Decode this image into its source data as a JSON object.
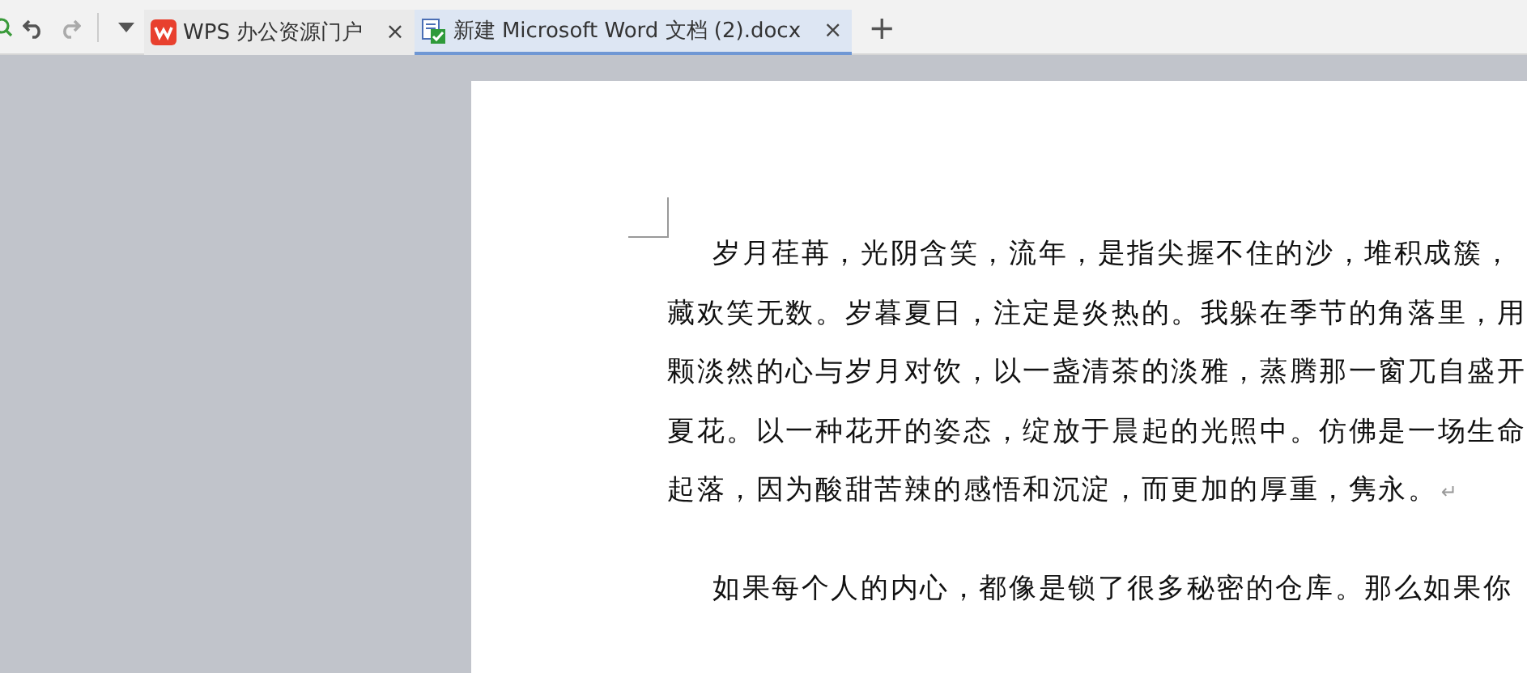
{
  "tabs": [
    {
      "label": "WPS 办公资源门户",
      "close": "×",
      "kind": "wps",
      "selected": false
    },
    {
      "label": "新建 Microsoft Word 文档 (2).docx",
      "close": "×",
      "kind": "doc",
      "selected": true
    }
  ],
  "new_tab": "+",
  "document": {
    "paragraphs": [
      {
        "lines": [
          "岁月荏苒，光阴含笑，流年，是指尖握不住的沙，堆积成簇，",
          "藏欢笑无数。岁暮夏日，注定是炎热的。我躲在季节的角落里，用",
          "颗淡然的心与岁月对饮，以一盏清茶的淡雅，蒸腾那一窗兀自盛开",
          "夏花。以一种花开的姿态，绽放于晨起的光照中。仿佛是一场生命",
          "起落，因为酸甜苦辣的感悟和沉淀，而更加的厚重，隽永。"
        ],
        "mark": "↵"
      },
      {
        "lines": [
          "如果每个人的内心，都像是锁了很多秘密的仓库。那么如果你"
        ]
      }
    ]
  }
}
